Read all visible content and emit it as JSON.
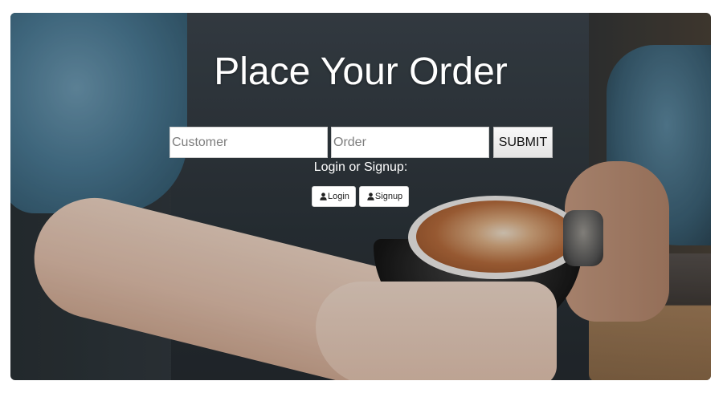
{
  "page": {
    "title": "Place Your Order"
  },
  "form": {
    "customer_placeholder": "Customer",
    "order_placeholder": "Order",
    "submit_label": "SUBMIT"
  },
  "auth": {
    "prompt": "Login or Signup:",
    "login_label": "Login",
    "signup_label": "Signup",
    "icon": "user-icon"
  },
  "colors": {
    "title_text": "#ffffff",
    "button_bg": "#ffffff"
  }
}
